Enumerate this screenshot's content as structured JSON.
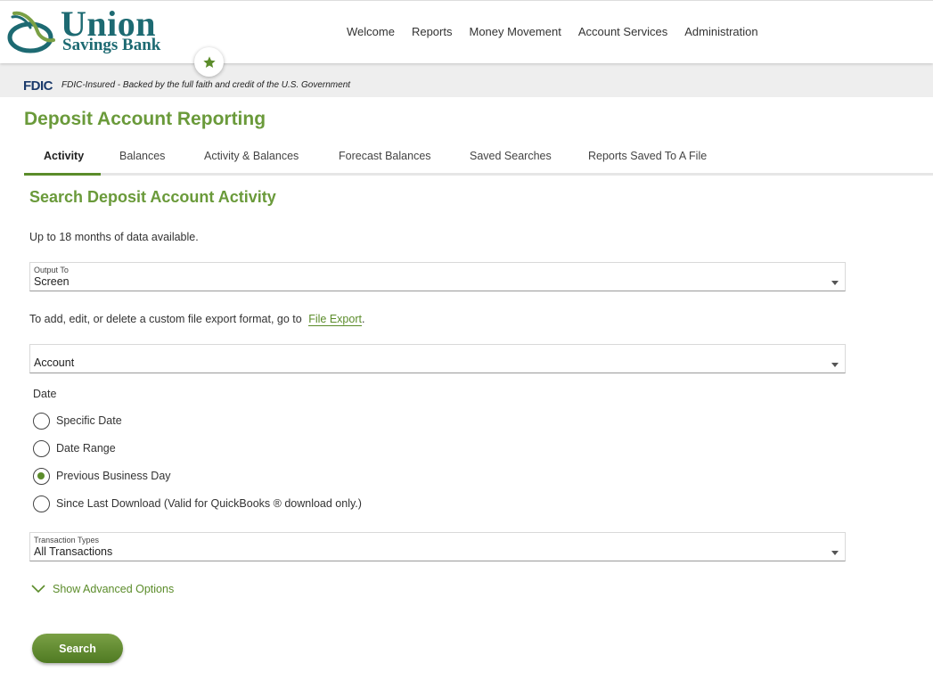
{
  "brand": {
    "line1": "Union",
    "line2": "Savings Bank",
    "primary_color": "#1d6a72",
    "accent_color": "#6a9a3a"
  },
  "nav": {
    "items": [
      "Welcome",
      "Reports",
      "Money Movement",
      "Account Services",
      "Administration"
    ]
  },
  "favorite": {
    "icon": "star-icon"
  },
  "fdic": {
    "logo": "FDIC",
    "text": "FDIC-Insured - Backed by the full faith and credit of the U.S. Government"
  },
  "page": {
    "title": "Deposit Account Reporting"
  },
  "tabs": [
    {
      "label": "Activity",
      "active": true
    },
    {
      "label": "Balances",
      "active": false
    },
    {
      "label": "Activity & Balances",
      "active": false
    },
    {
      "label": "Forecast Balances",
      "active": false
    },
    {
      "label": "Saved Searches",
      "active": false
    },
    {
      "label": "Reports Saved To A File",
      "active": false
    }
  ],
  "search": {
    "title": "Search Deposit Account Activity",
    "hint": "Up to 18 months of data available.",
    "output": {
      "label": "Output To",
      "value": "Screen"
    },
    "export_text": "To add, edit, or delete a custom file export format, go to",
    "export_link": "File Export",
    "export_suffix": ".",
    "account": {
      "placeholder": "Account"
    },
    "date": {
      "label": "Date",
      "options": [
        {
          "label": "Specific Date",
          "checked": false
        },
        {
          "label": "Date Range",
          "checked": false
        },
        {
          "label": "Previous Business Day",
          "checked": true
        },
        {
          "label": "Since Last Download (Valid for QuickBooks ® download only.)",
          "checked": false
        }
      ]
    },
    "transaction_types": {
      "label": "Transaction Types",
      "value": "All Transactions"
    },
    "advanced_label": "Show Advanced Options",
    "submit_label": "Search"
  }
}
